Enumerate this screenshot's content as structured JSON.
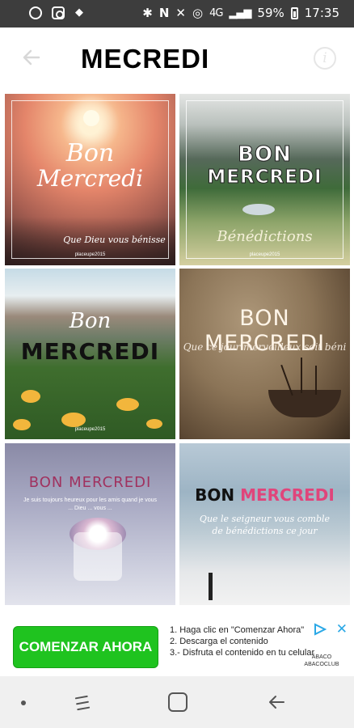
{
  "status_bar": {
    "battery": "59%",
    "time": "17:35",
    "network": "4G",
    "left_icons": [
      "circle-p-icon",
      "instagram-icon",
      "dropbox-icon"
    ],
    "right_icons": [
      "bluetooth-icon",
      "nfc-icon",
      "mute-icon",
      "alarm-icon",
      "signal-icon",
      "battery-icon"
    ]
  },
  "app_bar": {
    "title": "MECREDI",
    "back_icon": "back-arrow-icon",
    "info_icon": "info-icon"
  },
  "cards": [
    {
      "line1": "Bon",
      "line2": "Mercredi",
      "caption": "Que Dieu vous bénisse",
      "credit": "placeupe2015"
    },
    {
      "line1": "BON",
      "line2": "MERCREDI",
      "caption": "Bénédictions",
      "credit": "placeupe2015"
    },
    {
      "line1": "Bon",
      "line2": "MERCREDI",
      "credit": "placeupe2015"
    },
    {
      "line1": "BON MERCREDI",
      "caption": "Que ce jour merveilleux soit béni"
    },
    {
      "line1": "BON MERCREDI",
      "caption": "Je suis toujours heureux pour les amis quand je vous ... Dieu ... vous ..."
    },
    {
      "line1": "BON",
      "line2": "MERCREDI",
      "caption": "Que le seigneur vous comble de bénédictions ce jour"
    }
  ],
  "ad": {
    "button_label": "COMENZAR AHORA",
    "steps": [
      "1. Haga clic en \"Comenzar Ahora\"",
      "2. Descarga el contenido",
      "3.- Disfruta el contenido en tu celular"
    ],
    "brand_line1": "ÁBACO",
    "brand_line2": "ABACOCLUB",
    "close_glyph": "✕",
    "colors": {
      "button": "#1fc31f",
      "close": "#2aa8e6"
    }
  },
  "nav_bar": {
    "items": [
      "dot-icon",
      "recents-icon",
      "home-icon",
      "back-icon"
    ]
  }
}
